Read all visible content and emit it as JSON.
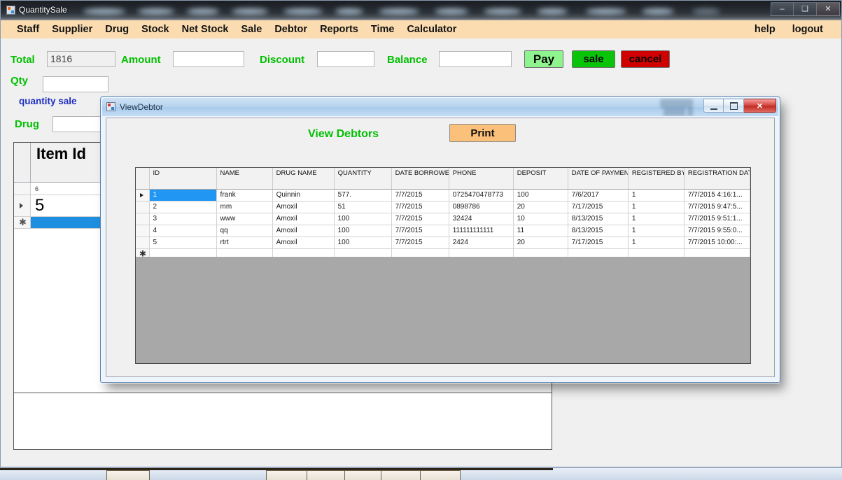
{
  "app": {
    "title": "QuantitySale",
    "window_controls": [
      {
        "name": "minimize",
        "glyph": "–"
      },
      {
        "name": "maximize",
        "glyph": "❑"
      },
      {
        "name": "close",
        "glyph": "✕"
      }
    ]
  },
  "menubar": {
    "items": [
      {
        "label": "Staff"
      },
      {
        "label": "Supplier"
      },
      {
        "label": "Drug"
      },
      {
        "label": "Stock"
      },
      {
        "label": "Net Stock"
      },
      {
        "label": "Sale"
      },
      {
        "label": "Debtor"
      },
      {
        "label": "Reports"
      },
      {
        "label": "Time"
      },
      {
        "label": "Calculator"
      }
    ],
    "right_items": [
      {
        "label": "help"
      },
      {
        "label": "logout"
      }
    ]
  },
  "entry": {
    "total_label": "Total",
    "total_value": "1816",
    "amount_label": "Amount",
    "amount_value": "",
    "discount_label": "Discount",
    "discount_value": "",
    "balance_label": "Balance",
    "balance_value": "",
    "qty_label": "Qty",
    "qty_value": "",
    "quantity_sale_label": "quantity sale",
    "drug_label": "Drug",
    "drug_value": "",
    "pay_button": "Pay",
    "sale_button": "sale",
    "cancel_button": "cancel"
  },
  "background_grid": {
    "header": "Item Id",
    "rows": [
      {
        "value": "6",
        "size": "small",
        "marker": ""
      },
      {
        "value": "5",
        "size": "big",
        "marker": "arrow"
      },
      {
        "value": "",
        "size": "new",
        "marker": "star"
      }
    ]
  },
  "dialog": {
    "title": "ViewDebtor",
    "heading": "View Debtors",
    "print_button": "Print",
    "window_controls": [
      {
        "name": "minimize"
      },
      {
        "name": "maximize"
      },
      {
        "name": "close",
        "glyph": "✕"
      }
    ],
    "table": {
      "columns": [
        "ID",
        "NAME",
        "DRUG NAME",
        "QUANTITY",
        "DATE BORROWED",
        "PHONE",
        "DEPOSIT",
        "DATE OF PAYMENT",
        "REGISTERED BY",
        "REGISTRATION DATE"
      ],
      "rows": [
        {
          "marker": "arrow",
          "selected_cell": 0,
          "cells": [
            "1",
            "frank",
            "Quinnin",
            "577.",
            "7/7/2015",
            "0725470478773",
            "100",
            "7/6/2017",
            "1",
            "7/7/2015 4:16:1..."
          ]
        },
        {
          "marker": "",
          "selected_cell": -1,
          "cells": [
            "2",
            "mm",
            "Amoxil",
            "51",
            "7/7/2015",
            "0898786",
            "20",
            "7/17/2015",
            "1",
            "7/7/2015 9:47:5..."
          ]
        },
        {
          "marker": "",
          "selected_cell": -1,
          "cells": [
            "3",
            "www",
            "Amoxil",
            "100",
            "7/7/2015",
            "32424",
            "10",
            "8/13/2015",
            "1",
            "7/7/2015 9:51:1..."
          ]
        },
        {
          "marker": "",
          "selected_cell": -1,
          "cells": [
            "4",
            "qq",
            "Amoxil",
            "100",
            "7/7/2015",
            "111111111111",
            "11",
            "8/13/2015",
            "1",
            "7/7/2015 9:55:0..."
          ]
        },
        {
          "marker": "",
          "selected_cell": -1,
          "cells": [
            "5",
            "rtrt",
            "Amoxil",
            "100",
            "7/7/2015",
            "2424",
            "20",
            "7/17/2015",
            "1",
            "7/7/2015 10:00:..."
          ]
        },
        {
          "marker": "star",
          "selected_cell": -1,
          "cells": [
            "",
            "",
            "",
            "",
            "",
            "",
            "",
            "",
            "",
            ""
          ]
        }
      ]
    }
  },
  "colors": {
    "menubar_bg": "#fbdcb0",
    "label_green": "#00c000",
    "label_blue": "#1f2fc0",
    "pay_green": "#8ef58e",
    "sale_green": "#0ac40a",
    "cancel_red": "#d10000",
    "print_orange": "#fbc07a",
    "selection_blue": "#2196f3",
    "grid_filler_gray": "#a8a8a8"
  }
}
